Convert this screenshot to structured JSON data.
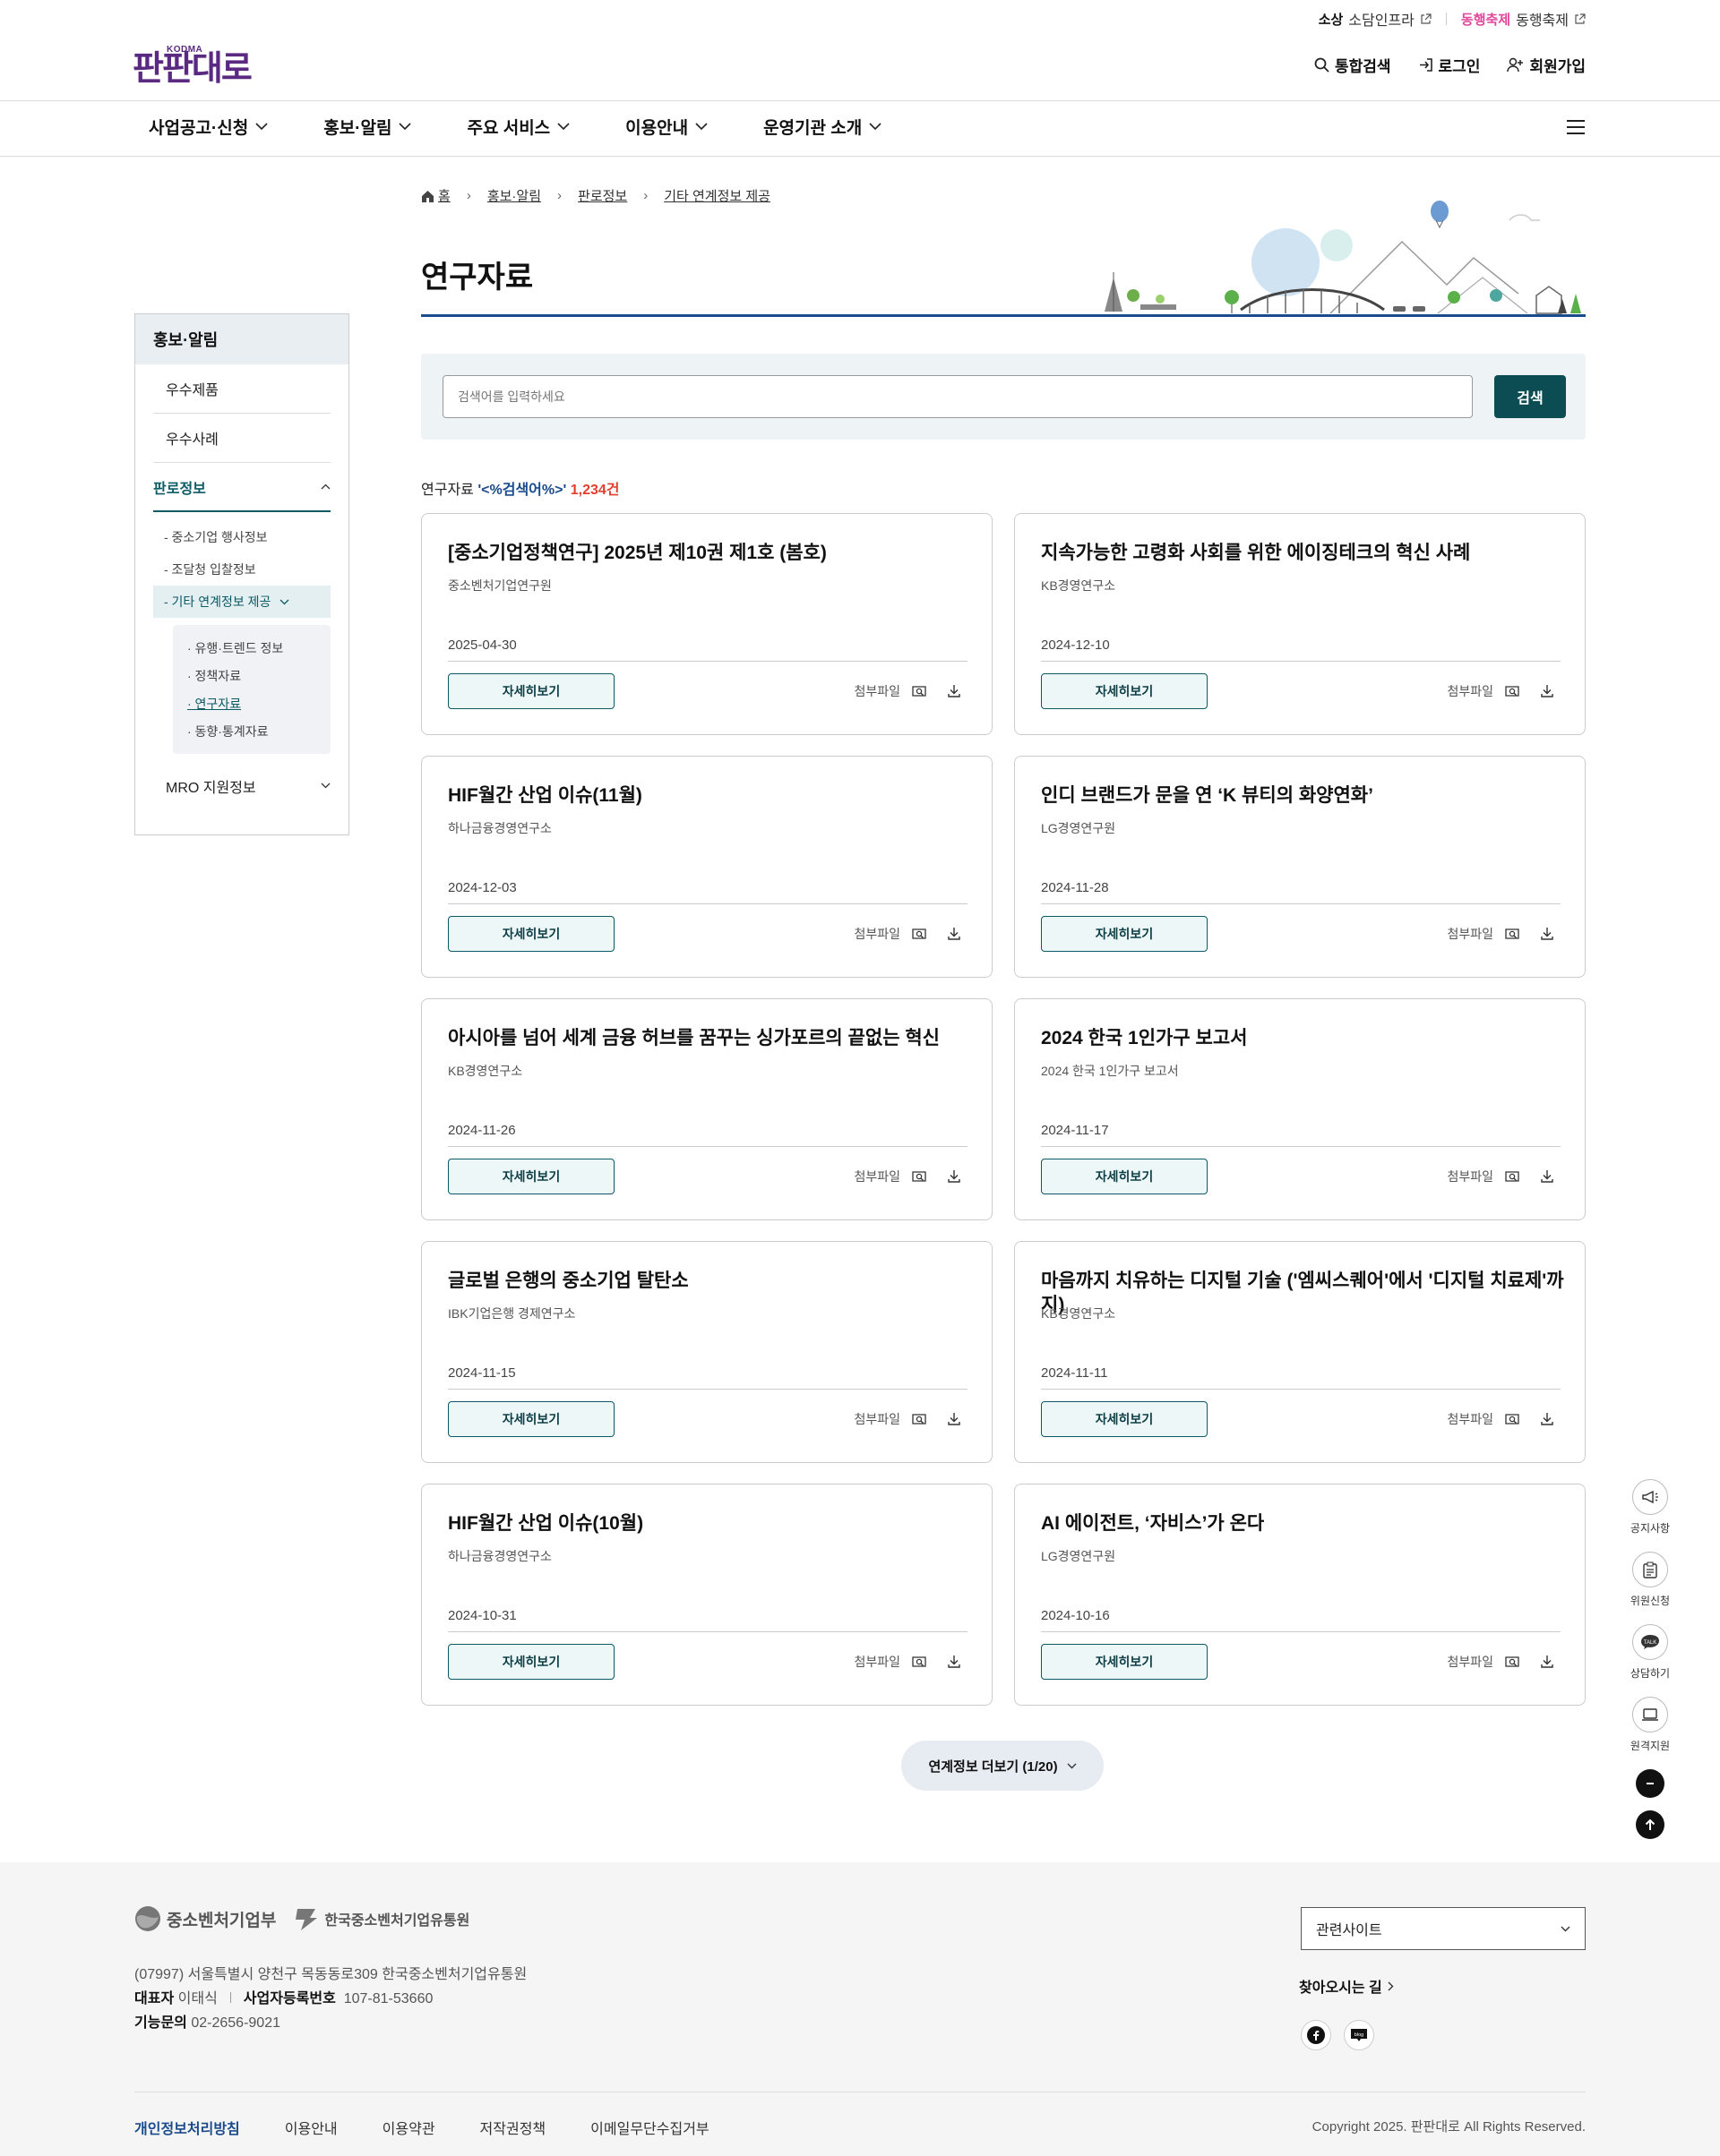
{
  "util": {
    "sodam_logo": "소상",
    "sodam_label": "소담인프라",
    "donghaeng_logo": "동행축제",
    "donghaeng_label": "동행축제"
  },
  "brand": {
    "small": "KODMA",
    "name": "판판대로"
  },
  "header": {
    "search": "통합검색",
    "login": "로그인",
    "join": "회원가입"
  },
  "gnb": [
    "사업공고·신청",
    "홍보·알림",
    "주요 서비스",
    "이용안내",
    "운영기관 소개"
  ],
  "breadcrumb": [
    "홈",
    "홍보·알림",
    "판로정보",
    "기타 연계정보 제공"
  ],
  "page_title": "연구자료",
  "sidebar": {
    "head": "홍보·알림",
    "items": [
      "우수제품",
      "우수사례",
      "판로정보"
    ],
    "sub": [
      "- 중소기업 행사정보",
      "- 조달청 입찰정보",
      "- 기타 연계정보 제공"
    ],
    "sub3": [
      "· 유행·트렌드 정보",
      "· 정책자료",
      "· 연구자료",
      "· 동향·통계자료"
    ],
    "last": "MRO 지원정보"
  },
  "search": {
    "placeholder": "검색어를 입력하세요",
    "button": "검색"
  },
  "count": {
    "prefix": "연구자료",
    "keyword": "'<%검색어%>'",
    "num": "1,234건"
  },
  "cards": [
    {
      "title": "[중소기업정책연구] 2025년 제10권 제1호 (봄호)",
      "org": "중소벤처기업연구원",
      "date": "2025-04-30"
    },
    {
      "title": "지속가능한 고령화 사회를 위한 에이징테크의 혁신 사례",
      "org": "KB경영연구소",
      "date": "2024-12-10"
    },
    {
      "title": "HIF월간 산업 이슈(11월)",
      "org": "하나금융경영연구소",
      "date": "2024-12-03"
    },
    {
      "title": "인디 브랜드가 문을 연 ‘K 뷰티의 화양연화’",
      "org": "LG경영연구원",
      "date": "2024-11-28"
    },
    {
      "title": "아시아를 넘어 세계 금융 허브를 꿈꾸는 싱가포르의 끝없는 혁신",
      "org": "KB경영연구소",
      "date": "2024-11-26"
    },
    {
      "title": "2024 한국 1인가구 보고서",
      "org": "2024 한국 1인가구 보고서",
      "date": "2024-11-17"
    },
    {
      "title": "글로벌 은행의 중소기업 탈탄소",
      "org": "IBK기업은행 경제연구소",
      "date": "2024-11-15"
    },
    {
      "title": "마음까지 치유하는 디지털 기술 ('엠씨스퀘어'에서 '디지털 치료제'까지)",
      "org": "KB경영연구소",
      "date": "2024-11-11"
    },
    {
      "title": "HIF월간 산업 이슈(10월)",
      "org": "하나금융경영연구소",
      "date": "2024-10-31"
    },
    {
      "title": "AI 에이전트, ‘자비스’가 온다",
      "org": "LG경영연구원",
      "date": "2024-10-16"
    }
  ],
  "card_labels": {
    "detail": "자세히보기",
    "attach": "첨부파일"
  },
  "more": "연계정보 더보기 (1/20)",
  "quick": [
    "공지사항",
    "위원신청",
    "상담하기",
    "원격지원"
  ],
  "footer": {
    "ministry": "중소벤처기업부",
    "agency": "한국중소벤처기업유통원",
    "address": "(07997) 서울특별시 양천구 목동동로309 한국중소벤처기업유통원",
    "ceo_label": "대표자",
    "ceo": "이태식",
    "biz_label": "사업자등록번호",
    "biz": "107-81-53660",
    "tel_label": "기능문의",
    "tel": "02-2656-9021",
    "related": "관련사이트",
    "directions": "찾아오시는 길",
    "links": [
      "개인정보처리방침",
      "이용안내",
      "이용약관",
      "저작권정책",
      "이메일무단수집거부"
    ],
    "copyright": "Copyright 2025. 판판대로 All Rights Reserved."
  },
  "colors": {
    "brand": "#5a2a82",
    "primary": "#0b4d52",
    "accent": "#1a4b8c",
    "count": "#e2402e"
  }
}
